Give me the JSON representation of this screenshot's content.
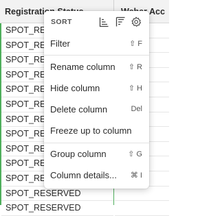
{
  "columns": {
    "registration_header": "Registration Status",
    "second_header": "Weber Acc"
  },
  "rows": [
    "SPOT_RESERVED",
    "SPOT_RESERVED",
    "SPOT_RESERVED",
    "SPOT_RESERVED",
    "SPOT_RESERVED",
    "SPOT_RESERVED",
    "SPOT_RESERVED",
    "SPOT_RESERVED",
    "SPOT_RESERVED",
    "SPOT_RESERVED",
    "SPOT_RESERVED",
    "SPOT_RESERVED",
    "SPOT_RESERVED"
  ],
  "menu": {
    "sort_label": "SORT",
    "icons": [
      "sort-ascending-icon",
      "sort-descending-icon",
      "settings-gear-icon"
    ],
    "items": [
      {
        "label": "Filter",
        "shortcut": "⇧ F"
      },
      {
        "label": "Rename column",
        "shortcut": "⇧ R"
      },
      {
        "label": "Hide column",
        "shortcut": "⇧ H"
      },
      {
        "label": "Delete column",
        "shortcut": "Del"
      },
      {
        "label": "Freeze up to column",
        "shortcut": ""
      },
      {
        "label": "Group column",
        "shortcut": "⇧ G"
      },
      {
        "label": "Column details...",
        "shortcut": "⌘ I"
      }
    ]
  },
  "colors": {
    "selection_border": "#4fae5c",
    "header_bg": "#f2f2f2"
  }
}
